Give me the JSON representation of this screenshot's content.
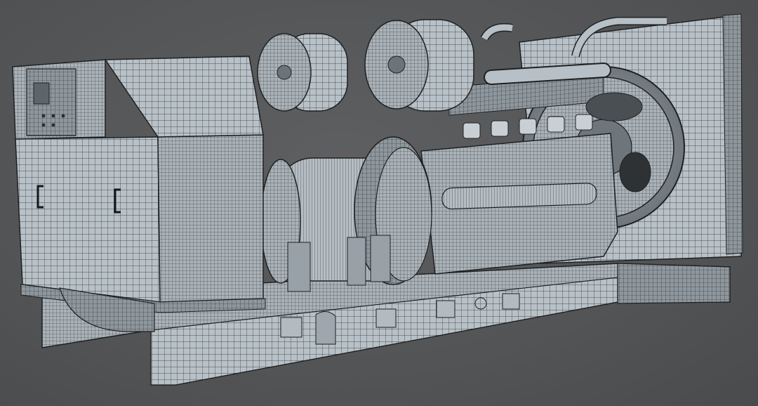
{
  "scene": {
    "subject": "",
    "background_color": "#555658",
    "mesh_base_color": "#b9c2c8",
    "mesh_shade_color": "#8e979d",
    "wire_color": "#2a2d30",
    "highlight_color": "#dde3e7"
  }
}
